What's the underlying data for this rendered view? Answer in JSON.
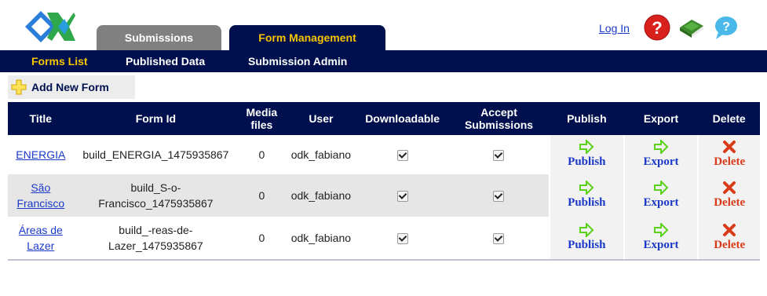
{
  "header": {
    "tabs": [
      {
        "label": "Submissions"
      },
      {
        "label": "Form Management"
      }
    ],
    "login": "Log In"
  },
  "nav": {
    "items": [
      {
        "label": "Forms List"
      },
      {
        "label": "Published Data"
      },
      {
        "label": "Submission Admin"
      }
    ]
  },
  "toolbar": {
    "add_label": "Add New Form"
  },
  "table": {
    "columns": [
      "Title",
      "Form Id",
      "Media files",
      "User",
      "Downloadable",
      "Accept Submissions",
      "Publish",
      "Export",
      "Delete"
    ],
    "rows": [
      {
        "title": "ENERGIA",
        "form_id": "build_ENERGIA_1475935867",
        "media": "0",
        "user": "odk_fabiano",
        "downloadable": true,
        "accept": true
      },
      {
        "title": "São Francisco",
        "form_id": "build_S-o-Francisco_1475935867",
        "media": "0",
        "user": "odk_fabiano",
        "downloadable": true,
        "accept": true
      },
      {
        "title": "Áreas de Lazer",
        "form_id": "build_-reas-de-Lazer_1475935867",
        "media": "0",
        "user": "odk_fabiano",
        "downloadable": true,
        "accept": true
      }
    ],
    "actions": {
      "publish": "Publish",
      "export": "Export",
      "delete": "Delete"
    }
  },
  "colors": {
    "navy": "#00104e",
    "gold": "#f8c400",
    "link": "#1a39c8",
    "delete": "#d93b1a",
    "arrow": "#5bd21a"
  }
}
